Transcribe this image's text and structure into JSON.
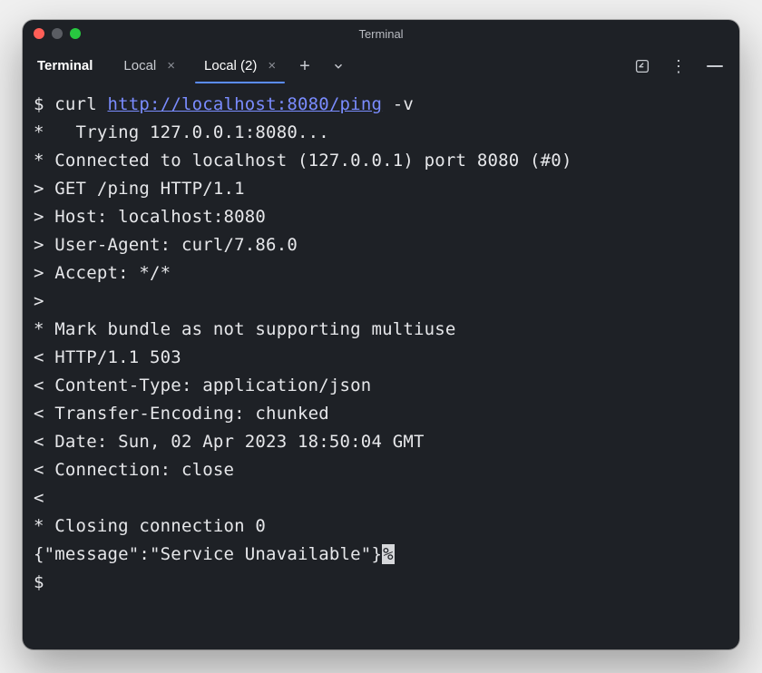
{
  "window": {
    "title": "Terminal"
  },
  "tabs": {
    "fixed_label": "Terminal",
    "items": [
      {
        "label": "Local",
        "active": false
      },
      {
        "label": "Local (2)",
        "active": true
      }
    ]
  },
  "terminal": {
    "prompt_prefix": "$ ",
    "command_prefix": "curl ",
    "command_url": "http://localhost:8080/ping",
    "command_suffix": " -v",
    "lines": [
      "*   Trying 127.0.0.1:8080...",
      "* Connected to localhost (127.0.0.1) port 8080 (#0)",
      "> GET /ping HTTP/1.1",
      "> Host: localhost:8080",
      "> User-Agent: curl/7.86.0",
      "> Accept: */*",
      ">",
      "* Mark bundle as not supporting multiuse",
      "< HTTP/1.1 503",
      "< Content-Type: application/json",
      "< Transfer-Encoding: chunked",
      "< Date: Sun, 02 Apr 2023 18:50:04 GMT",
      "< Connection: close",
      "<",
      "* Closing connection 0"
    ],
    "response_body": "{\"message\":\"Service Unavailable\"}",
    "trailing_char": "%",
    "next_prompt": "$"
  }
}
